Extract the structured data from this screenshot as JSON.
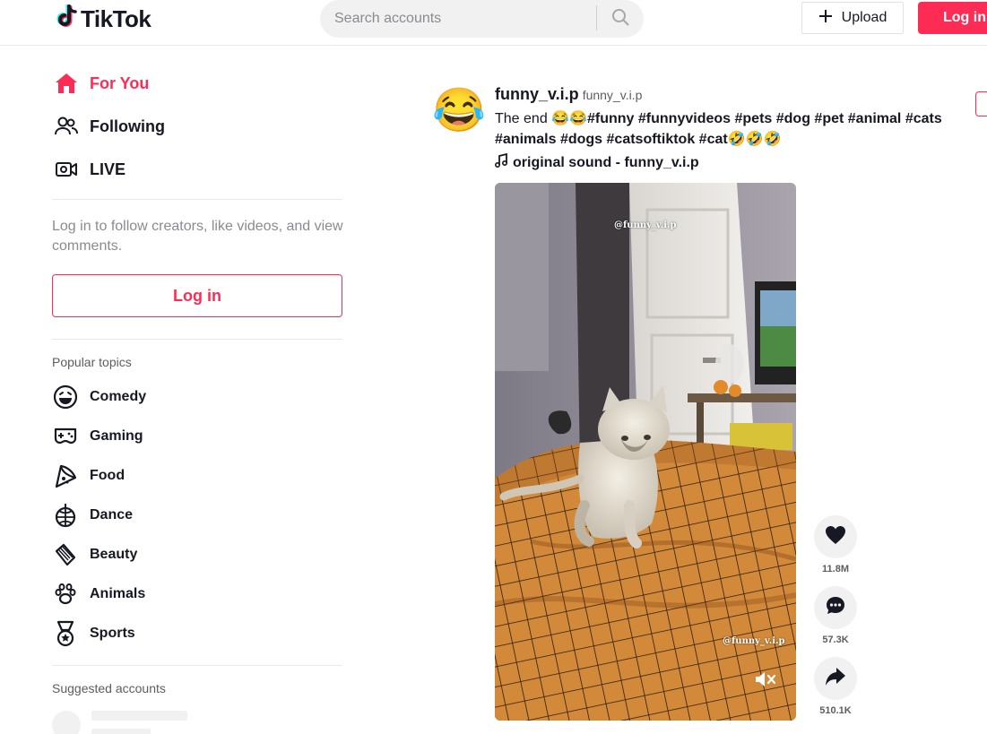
{
  "header": {
    "logo_text": "TikTok",
    "search_placeholder": "Search accounts",
    "upload_label": "Upload",
    "login_label": "Log in"
  },
  "sidebar": {
    "nav": [
      {
        "label": "For You",
        "icon": "home-icon",
        "active": true
      },
      {
        "label": "Following",
        "icon": "following-icon",
        "active": false
      },
      {
        "label": "LIVE",
        "icon": "live-icon",
        "active": false
      }
    ],
    "login_prompt": "Log in to follow creators, like videos, and view comments.",
    "login_label": "Log in",
    "popular_topics_title": "Popular topics",
    "topics": [
      {
        "label": "Comedy",
        "icon": "comedy-icon"
      },
      {
        "label": "Gaming",
        "icon": "gaming-icon"
      },
      {
        "label": "Food",
        "icon": "food-icon"
      },
      {
        "label": "Dance",
        "icon": "dance-icon"
      },
      {
        "label": "Beauty",
        "icon": "beauty-icon"
      },
      {
        "label": "Animals",
        "icon": "animals-icon"
      },
      {
        "label": "Sports",
        "icon": "sports-icon"
      }
    ],
    "suggested_title": "Suggested accounts"
  },
  "post": {
    "avatar_emoji": "😂",
    "author_name": "funny_v.i.p",
    "author_handle": "funny_v.i.p",
    "desc_prefix": "The end 😂😂",
    "hashtags": [
      "#funny",
      "#funnyvideos",
      "#pets",
      "#dog",
      "#pet",
      "#animal",
      "#cats",
      "#animals",
      "#dogs",
      "#catsoftiktok",
      "#cat"
    ],
    "desc_suffix": "🤣🤣🤣",
    "sound": "original sound - funny_v.i.p",
    "watermark_top": "@funny_v.i.p",
    "watermark_bottom": "@funny_v.i.p",
    "actions": [
      {
        "icon": "heart-icon",
        "count": "11.8M"
      },
      {
        "icon": "comment-icon",
        "count": "57.3K"
      },
      {
        "icon": "share-icon",
        "count": "510.1K"
      }
    ]
  },
  "colors": {
    "brand": "#fe2c55",
    "text": "#161823",
    "muted": "#8a8b91"
  }
}
